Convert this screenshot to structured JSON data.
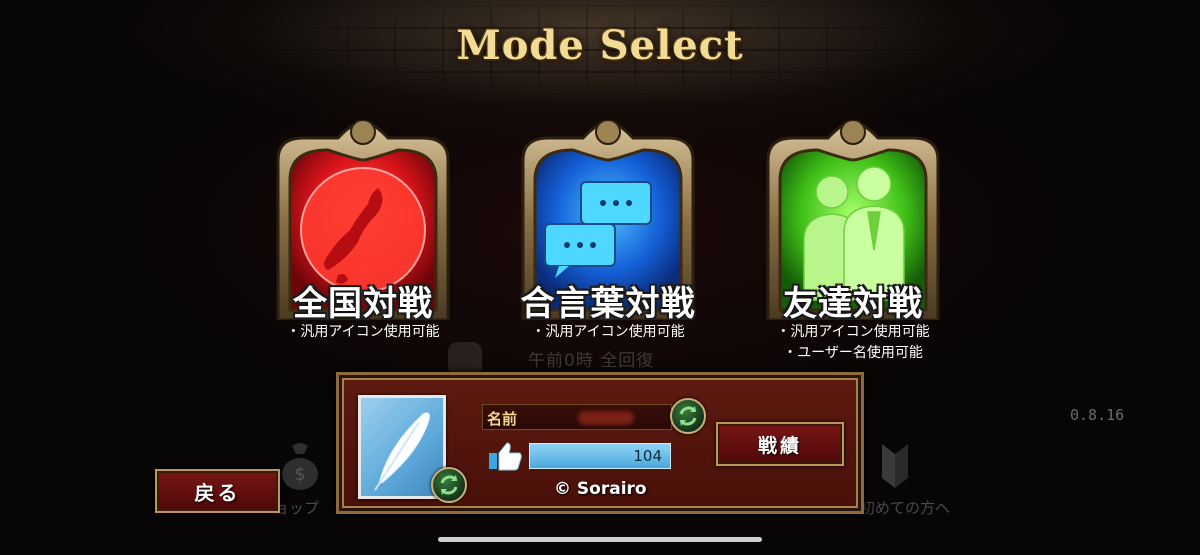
{
  "header": {
    "title": "Mode Select"
  },
  "modes": [
    {
      "label": "全国対戦",
      "notes": [
        "・汎用アイコン使用可能"
      ],
      "color": "#e01a1a",
      "icon": "japan-map-icon"
    },
    {
      "label": "合言葉対戦",
      "notes": [
        "・汎用アイコン使用可能"
      ],
      "color": "#1a6fe6",
      "icon": "chat-bubbles-icon"
    },
    {
      "label": "友達対戦",
      "notes": [
        "・汎用アイコン使用可能",
        "・ユーザー名使用可能"
      ],
      "color": "#4fcf1a",
      "icon": "friends-icon"
    }
  ],
  "background": {
    "recovery_notice": "午前0時 全回復",
    "version": "0.8.16",
    "shop_label": "ョップ",
    "beginner_label": "初めての方へ"
  },
  "profile": {
    "name_label": "名前",
    "like_count": "104",
    "copyright": "© Sorairo",
    "record_button": "戦績"
  },
  "nav": {
    "back_button": "戻る"
  }
}
